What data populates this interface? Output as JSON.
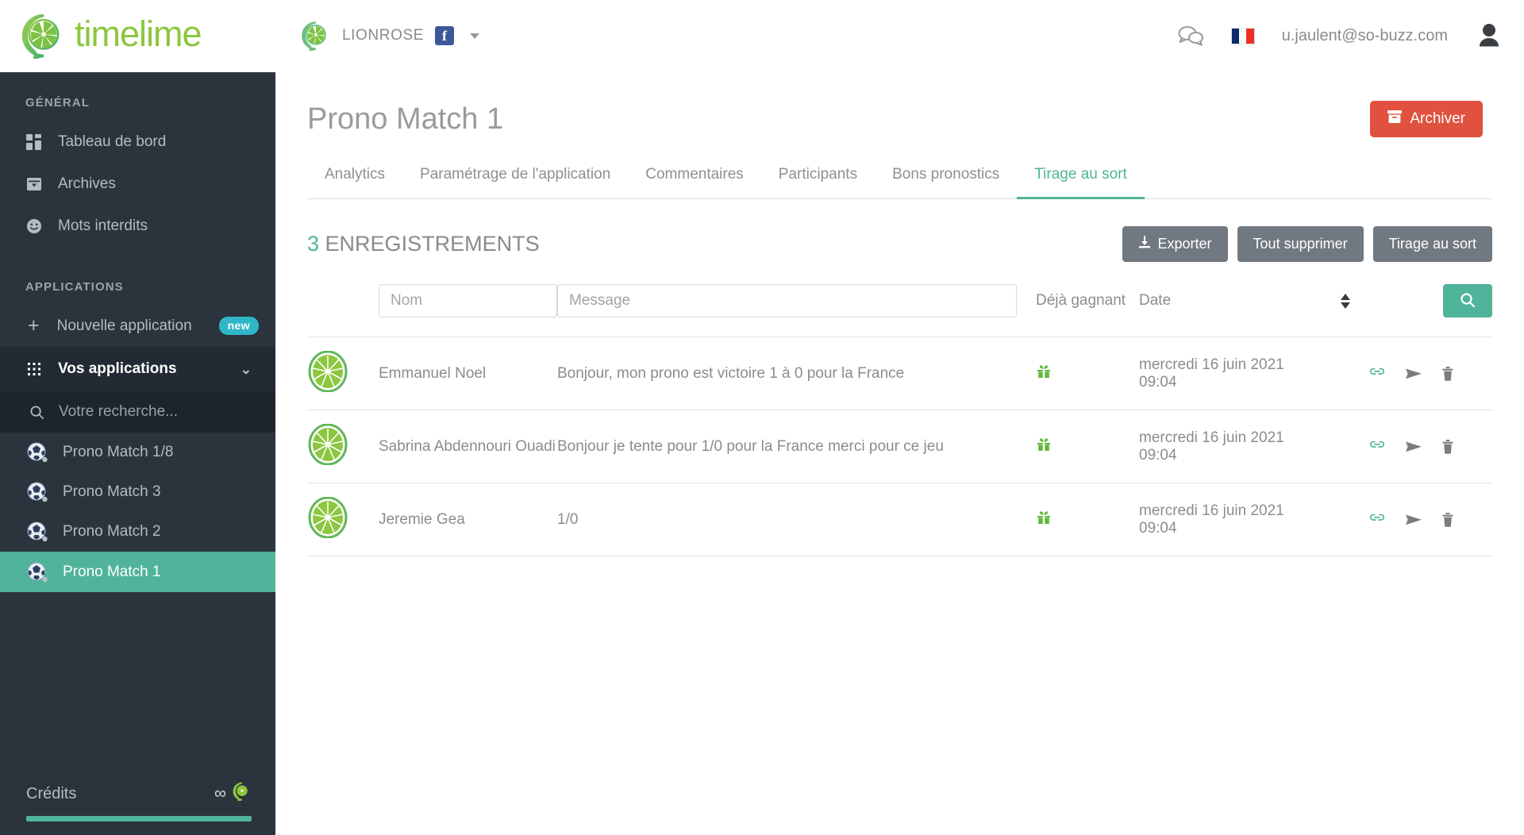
{
  "brand": {
    "name": "timelime",
    "logo_icon": "lime-speech-bubble-logo"
  },
  "topbar": {
    "page_selector": {
      "name": "LIONROSE",
      "network_icon": "facebook-icon",
      "caret_icon": "chevron-down-icon"
    },
    "chat_icon": "chat-bubbles-icon",
    "language_flag": "french-flag-icon",
    "user_email": "u.jaulent@so-buzz.com",
    "avatar_icon": "user-avatar-icon"
  },
  "sidebar": {
    "sections": [
      {
        "title": "GÉNÉRAL"
      },
      {
        "title": "APPLICATIONS"
      }
    ],
    "general_items": [
      {
        "label": "Tableau de bord",
        "icon": "dashboard-grid-icon"
      },
      {
        "label": "Archives",
        "icon": "archive-box-icon"
      },
      {
        "label": "Mots interdits",
        "icon": "smiley-face-icon"
      }
    ],
    "new_app": {
      "label": "Nouvelle application",
      "icon": "plus-icon",
      "badge": "new"
    },
    "your_apps": {
      "label": "Vos applications",
      "icon": "grid-dots-icon",
      "chevron": "chevron-down-icon"
    },
    "search": {
      "placeholder": "Votre recherche...",
      "value": "",
      "icon": "search-icon"
    },
    "apps": [
      {
        "label": "Prono Match 1/8",
        "icon": "soccer-ball-icon",
        "active": false
      },
      {
        "label": "Prono Match 3",
        "icon": "soccer-ball-icon",
        "active": false
      },
      {
        "label": "Prono Match 2",
        "icon": "soccer-ball-icon",
        "active": false
      },
      {
        "label": "Prono Match 1",
        "icon": "soccer-ball-icon",
        "active": true
      }
    ],
    "credits": {
      "label": "Crédits",
      "value": "∞",
      "icon": "lime-logo-icon",
      "progress_percent": 100
    }
  },
  "main": {
    "page_title": "Prono Match 1",
    "archive_button": {
      "label": "Archiver",
      "icon": "archive-box-icon",
      "color": "#e0513f"
    },
    "tabs": [
      {
        "label": "Analytics",
        "active": false
      },
      {
        "label": "Paramétrage de l'application",
        "active": false
      },
      {
        "label": "Commentaires",
        "active": false
      },
      {
        "label": "Participants",
        "active": false
      },
      {
        "label": "Bons pronostics",
        "active": false
      },
      {
        "label": "Tirage au sort",
        "active": true
      }
    ],
    "record_count": "3",
    "record_count_label": "ENREGISTREMENTS",
    "actions": [
      {
        "label": "Exporter",
        "icon": "download-icon"
      },
      {
        "label": "Tout supprimer",
        "icon": ""
      },
      {
        "label": "Tirage au sort",
        "icon": ""
      }
    ],
    "filters": {
      "nom_placeholder": "Nom",
      "nom_value": "",
      "message_placeholder": "Message",
      "message_value": "",
      "winner_label": "Déjà gagnant",
      "date_label": "Date",
      "sort_icon": "sort-updown-icon",
      "search_button_icon": "search-icon"
    },
    "rows": [
      {
        "avatar_icon": "lime-avatar-icon",
        "name": "Emmanuel Noel",
        "message": "Bonjour, mon prono est victoire 1 à 0 pour la France",
        "winner_icon": "gift-icon",
        "date": "mercredi 16 juin 2021 09:04",
        "link_icon": "link-icon",
        "send_icon": "send-icon",
        "delete_icon": "trash-icon"
      },
      {
        "avatar_icon": "lime-avatar-icon",
        "name": "Sabrina Abdennouri Ouadi",
        "message": "Bonjour je tente pour 1/0 pour la France merci pour ce jeu",
        "winner_icon": "gift-icon",
        "date": "mercredi 16 juin 2021 09:04",
        "link_icon": "link-icon",
        "send_icon": "send-icon",
        "delete_icon": "trash-icon"
      },
      {
        "avatar_icon": "lime-avatar-icon",
        "name": "Jeremie Gea",
        "message": "1/0",
        "winner_icon": "gift-icon",
        "date": "mercredi 16 juin 2021 09:04",
        "link_icon": "link-icon",
        "send_icon": "send-icon",
        "delete_icon": "trash-icon"
      }
    ]
  },
  "colors": {
    "accent_teal": "#4fb49a",
    "sidebar_bg": "#2b333c",
    "danger_red": "#e0513f",
    "brand_green": "#8cc63e",
    "badge_cyan": "#2fb7c9",
    "gift_green": "#5fb838"
  }
}
